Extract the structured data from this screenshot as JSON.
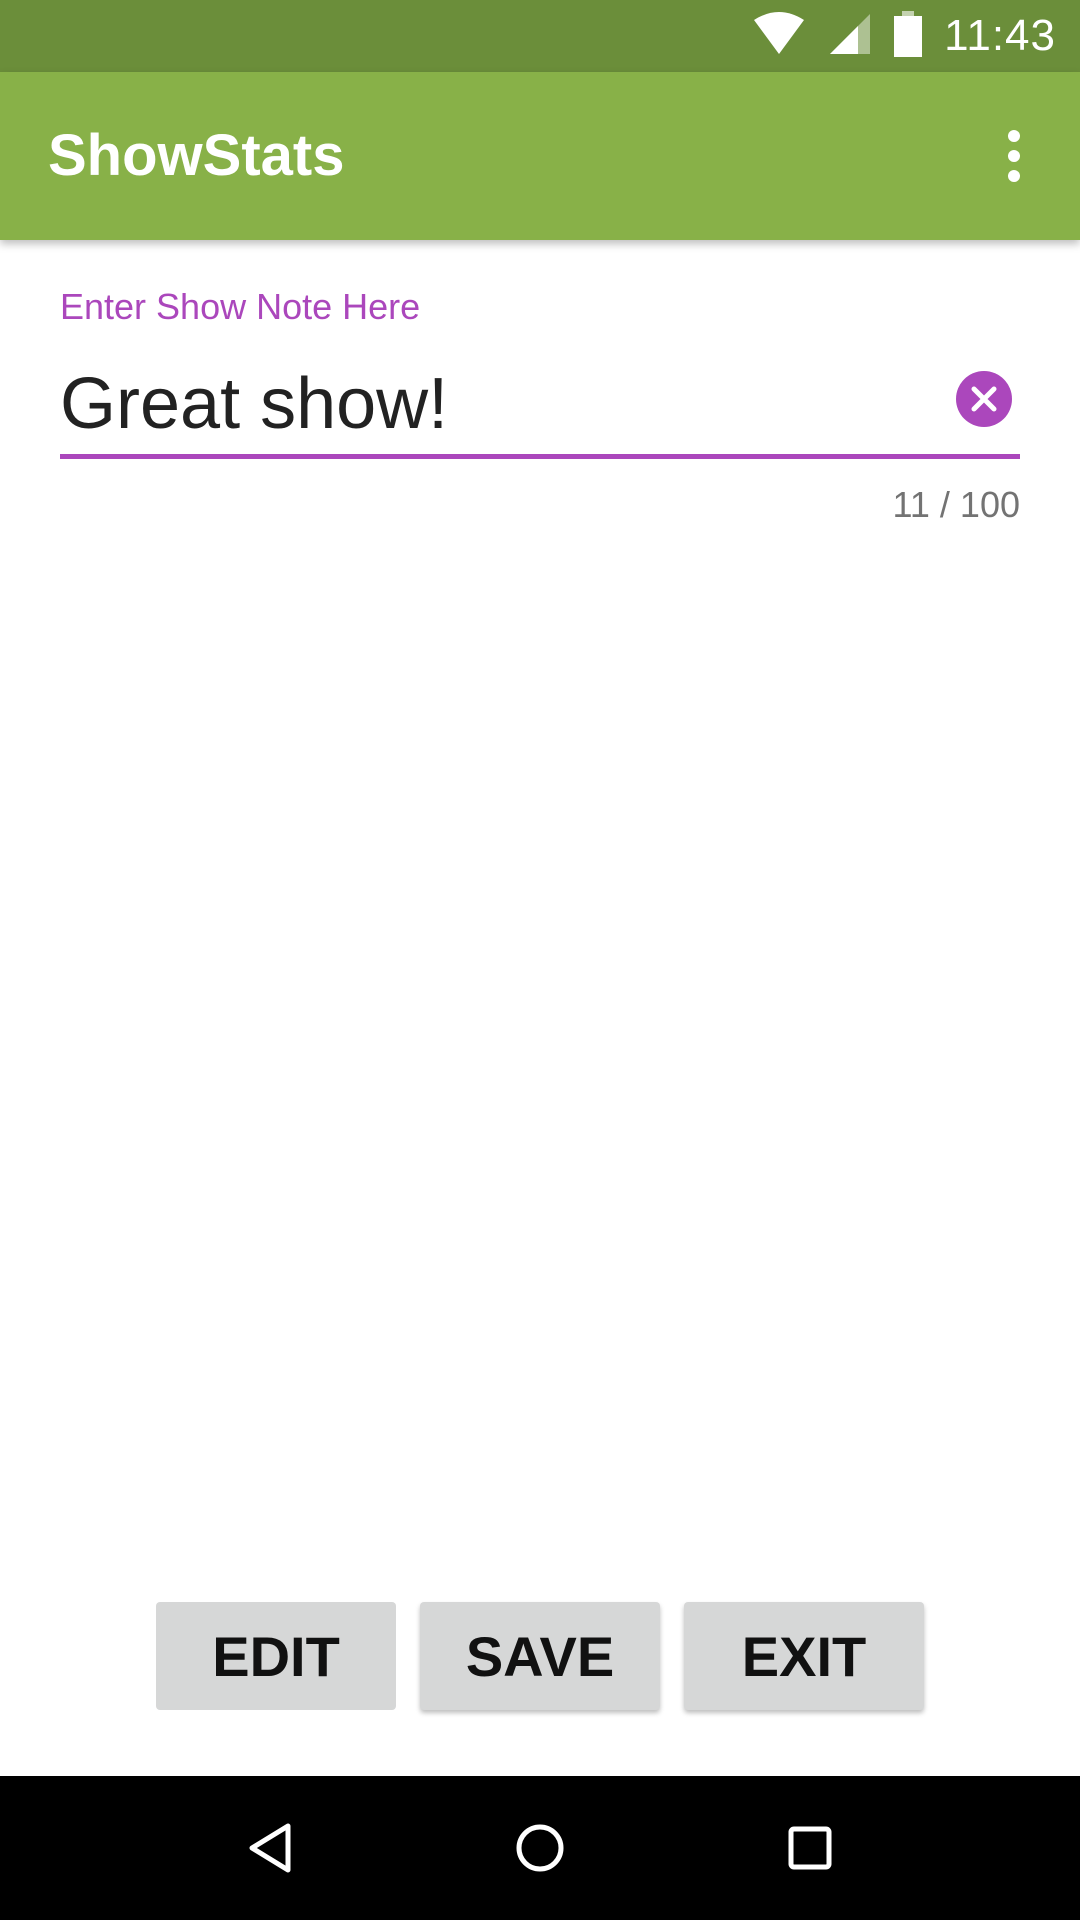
{
  "status_bar": {
    "time": "11:43",
    "icons": [
      "wifi-icon",
      "cell-signal-icon",
      "battery-icon"
    ],
    "background": "#6b8e3a"
  },
  "app_bar": {
    "title": "ShowStats",
    "menu_icon": "more-vert-icon",
    "background": "#88b148"
  },
  "note": {
    "label": "Enter Show Note Here",
    "value": "Great show!",
    "counter": "11 / 100",
    "accent": "#ab47bc",
    "clear_icon": "clear-icon"
  },
  "buttons": {
    "edit": "EDIT",
    "save": "SAVE",
    "exit": "EXIT"
  },
  "nav_bar": {
    "icons": [
      "back-icon",
      "home-icon",
      "recents-icon"
    ]
  }
}
